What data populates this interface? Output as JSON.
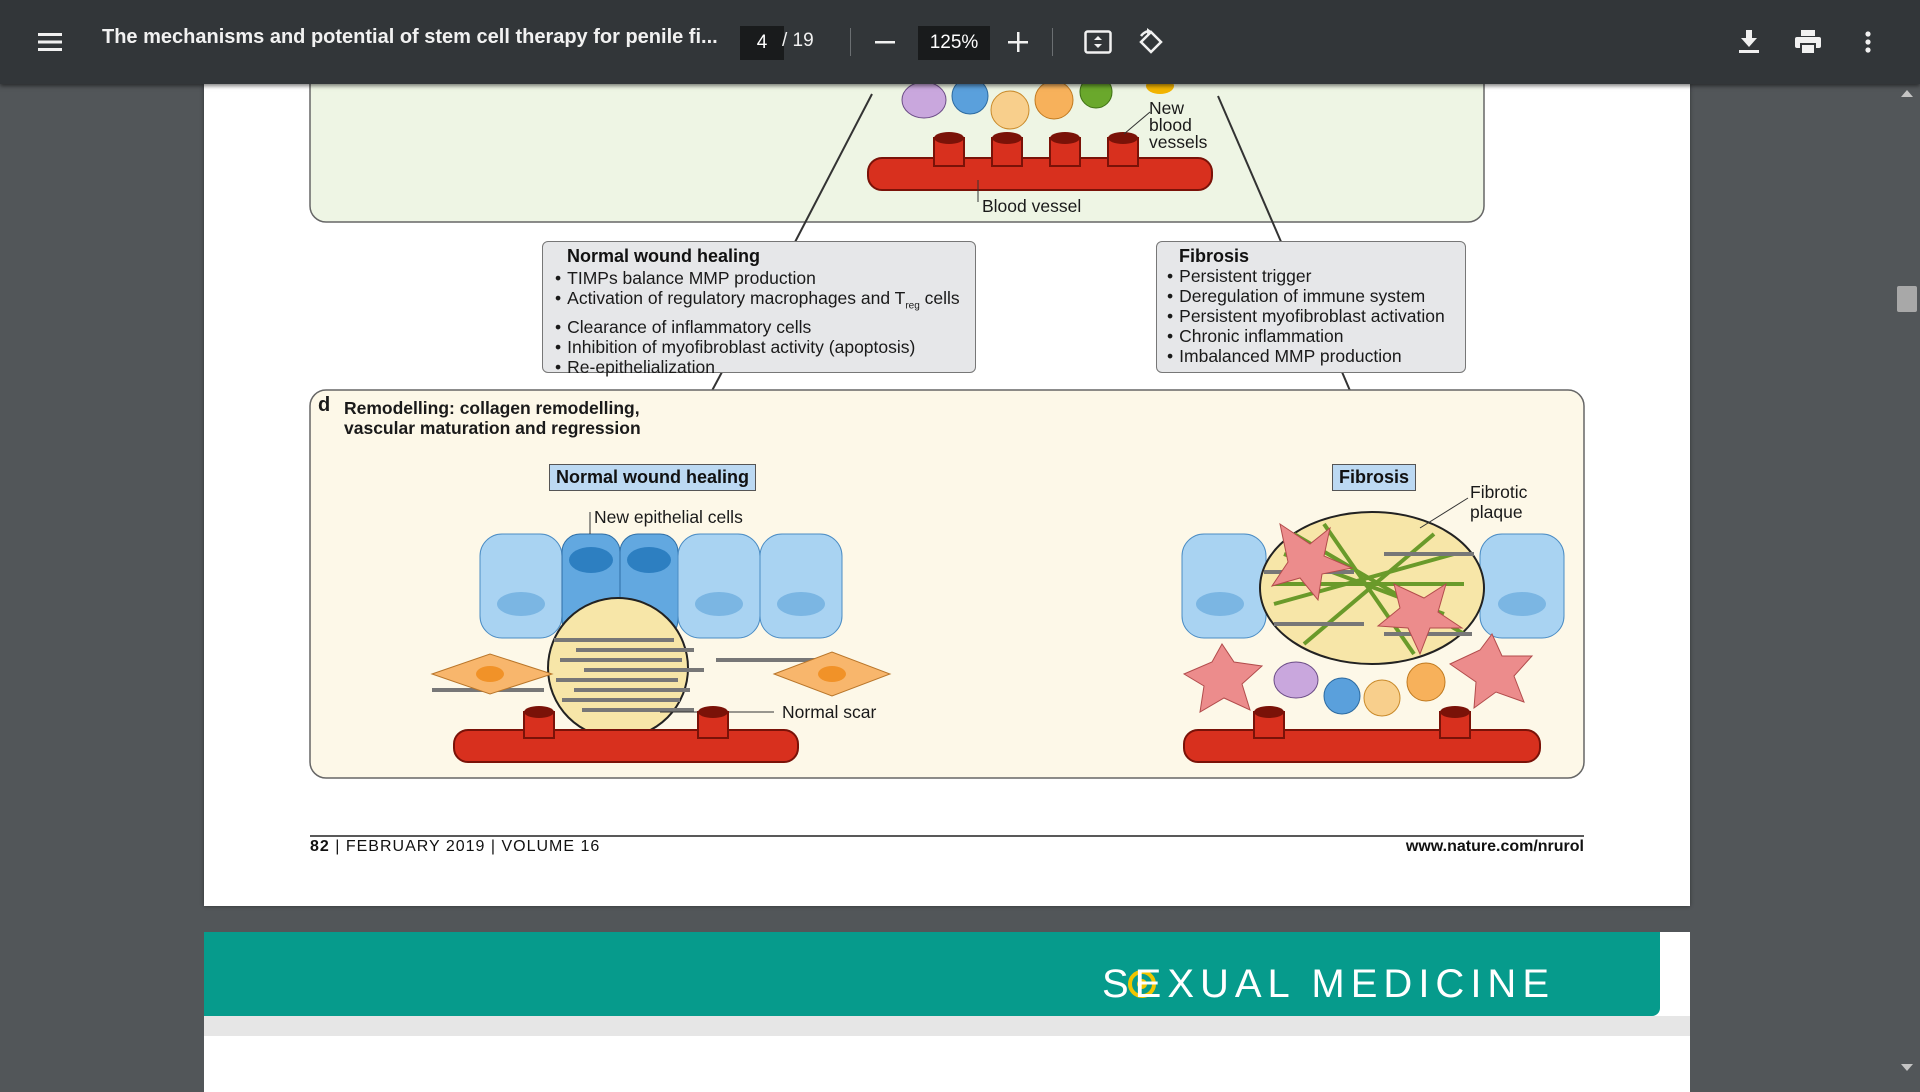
{
  "toolbar": {
    "title": "The mechanisms and potential of stem cell therapy for penile fi...",
    "page_current": "4",
    "page_total": "/ 19",
    "zoom": "125%"
  },
  "figure": {
    "new_blood_vessels_label": [
      "New",
      "blood",
      "vessels"
    ],
    "blood_vessel_label": "Blood vessel",
    "normal_box": {
      "heading": "Normal wound healing",
      "items": [
        "TIMPs balance MMP production",
        "Activation of regulatory macrophages and T",
        "Clearance of inflammatory cells",
        "Inhibition of myofibroblast activity (apoptosis)",
        "Re-epithelialization"
      ],
      "treg_sub": "reg",
      "treg_tail": " cells"
    },
    "fibrosis_box": {
      "heading": "Fibrosis",
      "items": [
        "Persistent trigger",
        "Deregulation of immune system",
        "Persistent myofibroblast activation",
        "Chronic inflammation",
        "Imbalanced MMP production"
      ]
    },
    "panel_d": {
      "letter": "d",
      "title_line1": "Remodelling: collagen remodelling,",
      "title_line2": "vascular maturation and regression",
      "tag_normal": "Normal wound healing",
      "tag_fibrosis": "Fibrosis",
      "new_epithelial": "New epithelial cells",
      "normal_scar": "Normal scar",
      "fibrotic_plaque": [
        "Fibrotic",
        "plaque"
      ]
    }
  },
  "footer": {
    "page_no": "82",
    "issue": "FEBRUARY 2019",
    "volume": "VOLUME 16",
    "url": "www.nature.com/nrurol"
  },
  "next_page": {
    "banner": "SEXUAL MEDICINE"
  }
}
